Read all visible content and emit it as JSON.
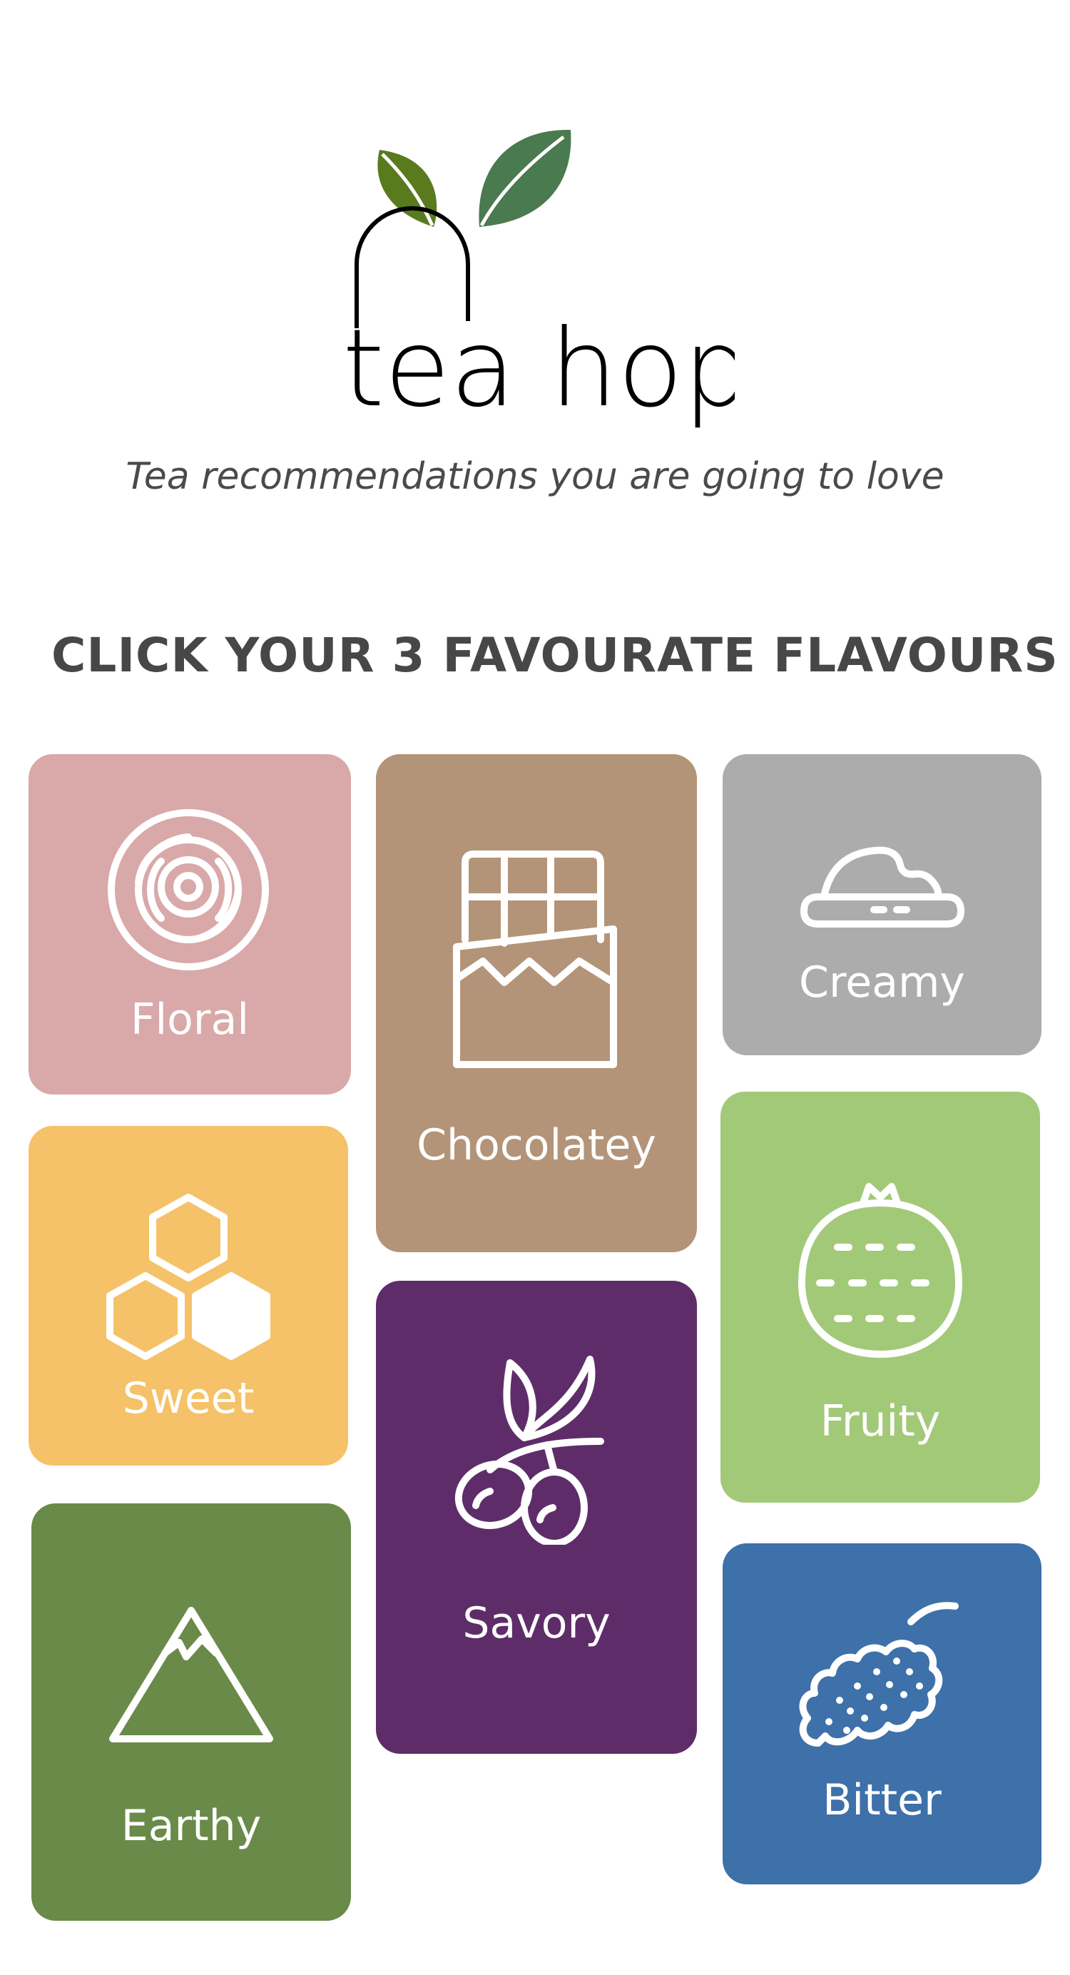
{
  "brand": {
    "name": "tea hop",
    "tagline": "Tea recommendations you are going to love",
    "leaf_colors": [
      "#5a7a1e",
      "#4a7a4f"
    ]
  },
  "heading": "CLICK YOUR 3 FAVOURATE FLAVOURS",
  "flavours": [
    {
      "key": "floral",
      "label": "Floral",
      "color": "#d9a8a8",
      "icon": "rose-icon"
    },
    {
      "key": "chocolatey",
      "label": "Chocolatey",
      "color": "#b39478",
      "icon": "chocolate-bar-icon"
    },
    {
      "key": "creamy",
      "label": "Creamy",
      "color": "#acacac",
      "icon": "cream-icon"
    },
    {
      "key": "sweet",
      "label": "Sweet",
      "color": "#f5c269",
      "icon": "honeycomb-icon"
    },
    {
      "key": "fruity",
      "label": "Fruity",
      "color": "#a2c978",
      "icon": "fruit-icon"
    },
    {
      "key": "savory",
      "label": "Savory",
      "color": "#5e2d69",
      "icon": "olive-branch-icon"
    },
    {
      "key": "earthy",
      "label": "Earthy",
      "color": "#6a8a49",
      "icon": "mountain-icon"
    },
    {
      "key": "bitter",
      "label": "Bitter",
      "color": "#3e70aa",
      "icon": "mulberry-icon"
    }
  ]
}
